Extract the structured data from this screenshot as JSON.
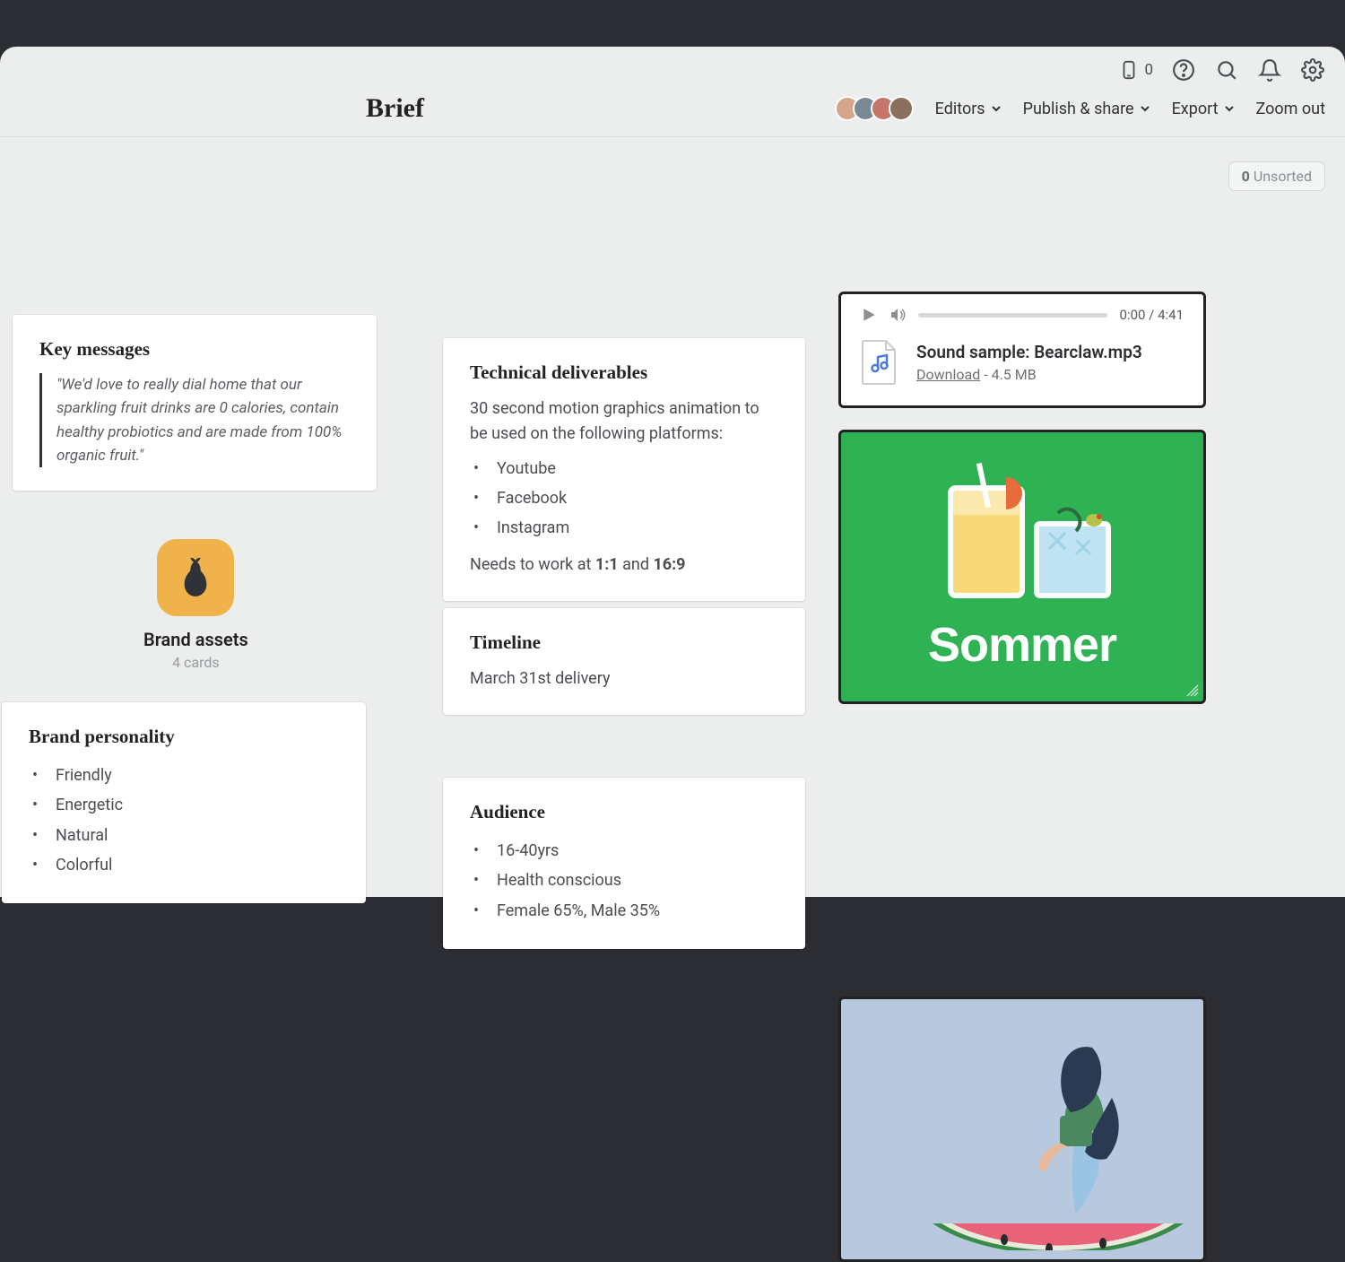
{
  "topbar": {
    "mobile_count": "0"
  },
  "header": {
    "title": "Brief",
    "editors_label": "Editors",
    "publish_label": "Publish & share",
    "export_label": "Export",
    "zoom_label": "Zoom out"
  },
  "unsorted": {
    "count": "0",
    "label": "Unsorted"
  },
  "cards": {
    "key_messages": {
      "title": "Key messages",
      "quote": "\"We'd love to really dial home that our sparkling fruit drinks are 0 calories, contain healthy probiotics and are made from 100% organic fruit.\""
    },
    "brand_assets": {
      "title": "Brand assets",
      "sub": "4 cards"
    },
    "brand_personality": {
      "title": "Brand personality",
      "items": [
        "Friendly",
        "Energetic",
        "Natural",
        "Colorful"
      ]
    },
    "technical": {
      "title": "Technical deliverables",
      "intro": "30 second motion graphics animation to be used on the following platforms:",
      "items": [
        "Youtube",
        "Facebook",
        "Instagram"
      ],
      "suffix_pre": "Needs to work at ",
      "ratio1": "1:1",
      "suffix_mid": " and ",
      "ratio2": "16:9"
    },
    "timeline": {
      "title": "Timeline",
      "body": "March 31st delivery"
    },
    "audience": {
      "title": "Audience",
      "items": [
        "16-40yrs",
        "Health conscious",
        "Female 65%, Male 35%"
      ]
    }
  },
  "audio": {
    "time": "0:00 / 4:41",
    "file_name": "Sound sample: Bearclaw.mp3",
    "download": "Download",
    "size": " - 4.5 MB"
  },
  "poster": {
    "title": "Sommer"
  }
}
